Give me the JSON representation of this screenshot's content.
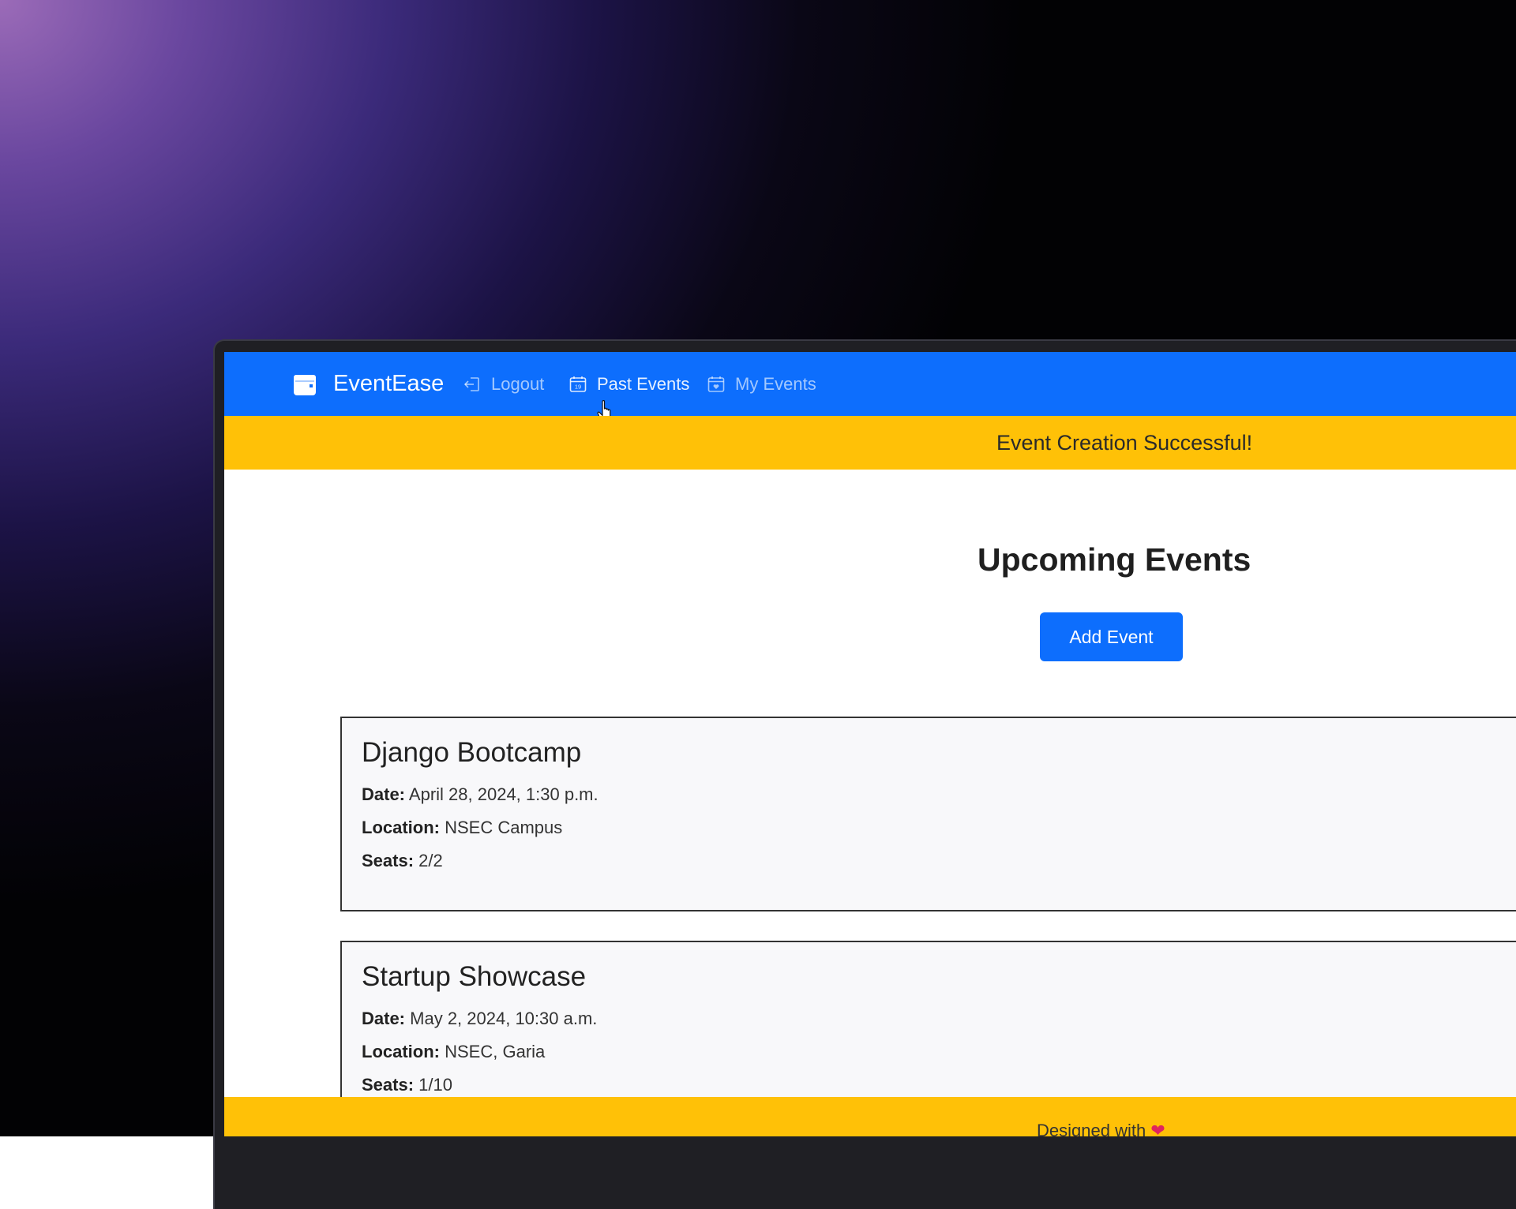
{
  "navbar": {
    "brand": "EventEase",
    "links": [
      {
        "label": "Logout",
        "icon": "logout-icon"
      },
      {
        "label": "Past Events",
        "icon": "calendar-icon"
      },
      {
        "label": "My Events",
        "icon": "calendar-heart-icon"
      }
    ]
  },
  "alert": {
    "message": "Event Creation Successful!"
  },
  "main": {
    "title": "Upcoming Events",
    "add_button_label": "Add Event"
  },
  "events": [
    {
      "name": "Django Bootcamp",
      "date_label": "Date:",
      "date": "April 28, 2024, 1:30 p.m.",
      "location_label": "Location:",
      "location": "NSEC Campus",
      "seats_label": "Seats:",
      "seats": "2/2"
    },
    {
      "name": "Startup Showcase",
      "date_label": "Date:",
      "date": "May 2, 2024, 10:30 a.m.",
      "location_label": "Location:",
      "location": "NSEC, Garia",
      "seats_label": "Seats:",
      "seats": "1/10"
    }
  ],
  "footer": {
    "text": "Designed with",
    "heart": "❤"
  },
  "colors": {
    "navbar": "#0d6efd",
    "alert": "#ffc107",
    "button": "#0d6efd",
    "footer": "#ffc107"
  }
}
